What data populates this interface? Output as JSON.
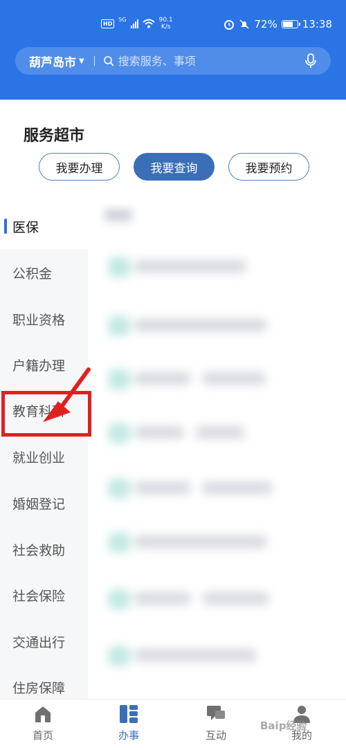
{
  "status_bar": {
    "network": "5G",
    "hd": "HD",
    "speed_value": "90.1",
    "speed_unit": "K/s",
    "battery": "72%",
    "time": "13:38"
  },
  "search": {
    "city": "葫芦岛市",
    "placeholder": "搜索服务、事项"
  },
  "section": {
    "title": "服务超市"
  },
  "tabs": [
    {
      "label": "我要办理",
      "active": false
    },
    {
      "label": "我要查询",
      "active": true
    },
    {
      "label": "我要预约",
      "active": false
    }
  ],
  "sidebar": {
    "items": [
      {
        "label": "医保",
        "active": true
      },
      {
        "label": "公积金"
      },
      {
        "label": "职业资格"
      },
      {
        "label": "户籍办理"
      },
      {
        "label": "教育科研"
      },
      {
        "label": "就业创业"
      },
      {
        "label": "婚姻登记"
      },
      {
        "label": "社会救助"
      },
      {
        "label": "社会保险"
      },
      {
        "label": "交通出行"
      },
      {
        "label": "住房保障"
      }
    ]
  },
  "bottom_nav": {
    "items": [
      {
        "label": "首页",
        "icon": "home-icon"
      },
      {
        "label": "办事",
        "icon": "grid-icon",
        "active": true
      },
      {
        "label": "互动",
        "icon": "chat-icon"
      },
      {
        "label": "我的",
        "icon": "user-icon"
      }
    ]
  },
  "colors": {
    "header": "#2a74e6",
    "accent": "#3a6fb8",
    "annotation": "#e02020"
  }
}
